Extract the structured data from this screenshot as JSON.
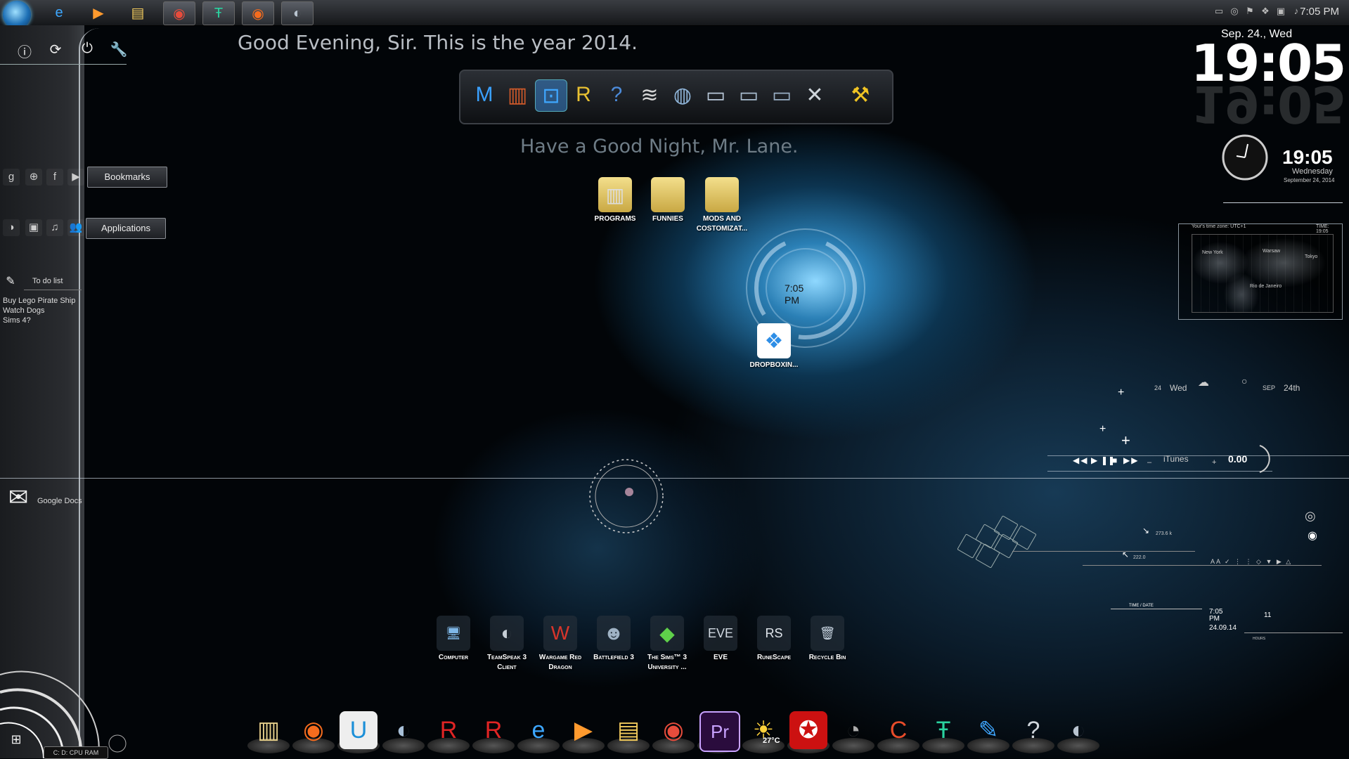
{
  "taskbar": {
    "apps": [
      {
        "name": "internet-explorer",
        "glyph": "e",
        "color": "#3da7ff"
      },
      {
        "name": "media-player",
        "glyph": "▶",
        "color": "#ff9a2e"
      },
      {
        "name": "file-explorer",
        "glyph": "▤",
        "color": "#f0c95c"
      },
      {
        "name": "chrome",
        "glyph": "◉",
        "color": "#e74c3c"
      },
      {
        "name": "teamspeak-red",
        "glyph": "Ŧ",
        "color": "#2ad29f"
      },
      {
        "name": "origin",
        "glyph": "◉",
        "color": "#f56c1e"
      },
      {
        "name": "steam-like",
        "glyph": "◐",
        "color": "#b9c4d0"
      }
    ],
    "clock": "7:05 PM"
  },
  "greeting": {
    "top": "Good Evening, Sir.  This is the year 2014.",
    "bottom": "Have a Good Night, Mr. Lane."
  },
  "left_panel": {
    "power_icons": [
      "info-icon",
      "refresh-icon",
      "power-icon",
      "wrench-icon"
    ],
    "bookmark_icons": [
      "g",
      "⊕",
      "f",
      "▶"
    ],
    "bookmarks_label": "Bookmarks",
    "app_icons": [
      "◑",
      "▣",
      "♫",
      "👥"
    ],
    "applications_label": "Applications",
    "todo_label": "To do list",
    "todo_items": [
      "Buy Lego Pirate Ship",
      "Watch Dogs",
      "Sims 4?"
    ],
    "google_docs": "Google Docs",
    "meter_labels": "C:  D:  CPU  RAM"
  },
  "top_dock": [
    {
      "name": "malwarebytes",
      "glyph": "M",
      "color": "#3aa0ff"
    },
    {
      "name": "winrar",
      "glyph": "▥",
      "color": "#d05a2a"
    },
    {
      "name": "toolbox",
      "glyph": "⊡",
      "color": "#3fa7ff"
    },
    {
      "name": "rainmeter-r",
      "glyph": "R",
      "color": "#e8c032"
    },
    {
      "name": "help",
      "glyph": "?",
      "color": "#4c8ad8"
    },
    {
      "name": "layers",
      "glyph": "≋",
      "color": "#d6d6d6"
    },
    {
      "name": "globe-doc",
      "glyph": "◍",
      "color": "#8fb4d8"
    },
    {
      "name": "folder-1",
      "glyph": "▭",
      "color": "#b8c7d8"
    },
    {
      "name": "folder-2",
      "glyph": "▭",
      "color": "#a8bccf"
    },
    {
      "name": "folder-3",
      "glyph": "▭",
      "color": "#98aec4"
    },
    {
      "name": "tools",
      "glyph": "✕",
      "color": "#cfd5db"
    },
    {
      "name": "hammer",
      "glyph": "⚒",
      "color": "#f0c424"
    }
  ],
  "desktop_folders": [
    {
      "label": "PROGRAMS"
    },
    {
      "label": "FUNNIES"
    },
    {
      "label": "MODS AND COSTOMIZAT..."
    }
  ],
  "center_clock": "7:05\nPM",
  "dropbox": {
    "label": "DROPBOXIN..."
  },
  "desktop_shortcuts": [
    {
      "label": "Computer",
      "glyph": "🖥",
      "color": "#7fb8e8"
    },
    {
      "label": "TeamSpeak 3 Client",
      "glyph": "◐",
      "color": "#c6ced6"
    },
    {
      "label": "Wargame Red Dragon",
      "glyph": "W",
      "color": "#d8352b"
    },
    {
      "label": "Battlefield 3",
      "glyph": "☻",
      "color": "#9fb2c4"
    },
    {
      "label": "The Sims™ 3 University ...",
      "glyph": "◆",
      "color": "#5fd04a"
    },
    {
      "label": "EVE",
      "glyph": "EVE",
      "color": "#d0d8e0"
    },
    {
      "label": "RuneScape",
      "glyph": "RS",
      "color": "#e0e6ec"
    },
    {
      "label": "Recycle Bin",
      "glyph": "🗑",
      "color": "#c8d4e0"
    }
  ],
  "bottom_dock": [
    {
      "name": "files",
      "glyph": "▥",
      "color": "#e6cf8a"
    },
    {
      "name": "origin",
      "glyph": "◉",
      "color": "#f56c1e"
    },
    {
      "name": "uplay",
      "glyph": "U",
      "color": "#1b8fd8"
    },
    {
      "name": "steam",
      "glyph": "◐",
      "color": "#a8c0d8"
    },
    {
      "name": "roblox-1",
      "glyph": "R",
      "color": "#e02424"
    },
    {
      "name": "roblox-2",
      "glyph": "R",
      "color": "#e02424"
    },
    {
      "name": "internet-explorer",
      "glyph": "e",
      "color": "#3da7ff"
    },
    {
      "name": "media-player",
      "glyph": "▶",
      "color": "#ff9a2e"
    },
    {
      "name": "explorer",
      "glyph": "▤",
      "color": "#f0c95c"
    },
    {
      "name": "chrome",
      "glyph": "◉",
      "color": "#e74c3c"
    },
    {
      "name": "premiere",
      "glyph": "Pr",
      "color": "#c9a3ff"
    },
    {
      "name": "weather",
      "glyph": "☀",
      "color": "#ffd23a"
    },
    {
      "name": "creative-cloud",
      "glyph": "✪",
      "color": "#e33"
    },
    {
      "name": "cheat-engine",
      "glyph": "◔",
      "color": "#aaa"
    },
    {
      "name": "ccleaner",
      "glyph": "C",
      "color": "#e84c2a"
    },
    {
      "name": "teamspeak-red",
      "glyph": "Ŧ",
      "color": "#2ad29f"
    },
    {
      "name": "paint",
      "glyph": "✎",
      "color": "#3fa6ff"
    },
    {
      "name": "help",
      "glyph": "?",
      "color": "#cfd5db"
    },
    {
      "name": "teamspeak",
      "glyph": "◐",
      "color": "#b9c4d0"
    }
  ],
  "weather_temp": "27°C",
  "big_clock": {
    "date": "Sep. 24., Wed",
    "time": "19:05"
  },
  "analog_clock": {
    "time": "19:05",
    "day": "Wednesday",
    "date": "September 24, 2014"
  },
  "world_map": {
    "header_left": "Your's time zone: UTC+1",
    "header_right": "TIME: 19:05",
    "cities": [
      "New York",
      "Warsaw",
      "Tokyo",
      "Rio de Janeiro"
    ]
  },
  "date_widget": {
    "day_num": "24",
    "day": "Wed",
    "month": "SEP",
    "day_ord": "24th"
  },
  "itunes": {
    "label": "iTunes",
    "value": "0.00"
  },
  "net": {
    "up": "273.6 k",
    "down": "222.0"
  },
  "time_widget": {
    "title": "TIME / DATE",
    "time": "7:05\nPM",
    "date": "24.09.14",
    "num": "11",
    "hours": "HOURS"
  }
}
